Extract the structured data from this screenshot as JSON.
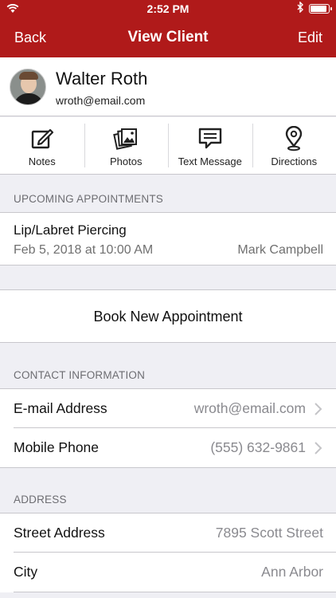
{
  "status_bar": {
    "time": "2:52 PM"
  },
  "nav": {
    "back_label": "Back",
    "title": "View Client",
    "edit_label": "Edit"
  },
  "client": {
    "name": "Walter Roth",
    "email": "wroth@email.com"
  },
  "actions": [
    {
      "label": "Notes",
      "icon": "notes-icon"
    },
    {
      "label": "Photos",
      "icon": "photos-icon"
    },
    {
      "label": "Text Message",
      "icon": "text-message-icon"
    },
    {
      "label": "Directions",
      "icon": "directions-icon"
    }
  ],
  "upcoming": {
    "header": "UPCOMING APPOINTMENTS",
    "items": [
      {
        "title": "Lip/Labret Piercing",
        "date": "Feb 5, 2018 at 10:00 AM",
        "staff": "Mark Campbell"
      }
    ],
    "book_label": "Book New Appointment"
  },
  "contact": {
    "header": "CONTACT INFORMATION",
    "rows": [
      {
        "label": "E-mail Address",
        "value": "wroth@email.com"
      },
      {
        "label": "Mobile Phone",
        "value": "(555) 632-9861"
      }
    ]
  },
  "address": {
    "header": "ADDRESS",
    "rows": [
      {
        "label": "Street Address",
        "value": "7895 Scott Street"
      },
      {
        "label": "City",
        "value": "Ann Arbor"
      }
    ]
  },
  "colors": {
    "brand": "#b01a1a",
    "background": "#efeff4",
    "secondary_text": "#8a8a8f"
  }
}
